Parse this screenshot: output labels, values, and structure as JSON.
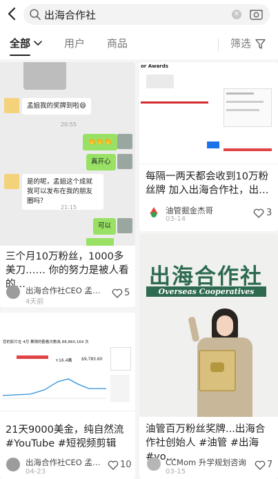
{
  "search": {
    "query": "出海合作社"
  },
  "tabs": [
    {
      "label": "全部"
    },
    {
      "label": "用户"
    },
    {
      "label": "商品"
    }
  ],
  "filter_label": "筛选",
  "colors": {
    "accent": "#222222",
    "tab_inactive": "#777777",
    "chat_green": "#98e165",
    "brand_green": "#2d6a50"
  },
  "posts": [
    {
      "title": "三个月10万粉丝，1000多美刀…… 你的努力是被人看的…",
      "author": "出海合作社CEO 孟…",
      "date": "4天前",
      "likes": "5",
      "image": {
        "kind": "chat",
        "messages": [
          {
            "side": "left",
            "text": "孟姐我的奖牌到啦😄"
          },
          {
            "side": "time",
            "text": "20:55"
          },
          {
            "side": "right",
            "text": "👏👏👏"
          },
          {
            "side": "right",
            "text": "真开心"
          },
          {
            "side": "left",
            "text": "是的呢，孟姐这个成就我可以发布在我的朋友圈吗？"
          },
          {
            "side": "time",
            "text": "21:15"
          },
          {
            "side": "right",
            "text": "可以"
          }
        ]
      }
    },
    {
      "title": "每隔一两天都会收到10万粉丝牌 加入出海合作社，出…",
      "author": "油管掘金杰哥",
      "date": "03-14",
      "likes": "3",
      "image": {
        "kind": "screenshot",
        "heading": "or Awards"
      }
    },
    {
      "title": "21天9000美金，纯自然流 #YouTube #短视频剪辑",
      "author": "出海合作社CEO 孟…",
      "date": "04-23",
      "likes": "10",
      "image": {
        "kind": "analytics",
        "headline": "您的影片在 4月 累積的觀看次數為 88,860,164 次",
        "stat_a": "+16.4萬",
        "stat_b": "$9,783.60"
      }
    },
    {
      "title": "油管百万粉丝奖牌...出海合作社创始人 #油管 #出海 #yo…",
      "author": "CCMom 升学规划咨询",
      "date": "03-15",
      "likes": "7",
      "image": {
        "kind": "photo",
        "logo_cn": "出海合作社",
        "logo_en": "Overseas Cooperatives"
      }
    }
  ]
}
